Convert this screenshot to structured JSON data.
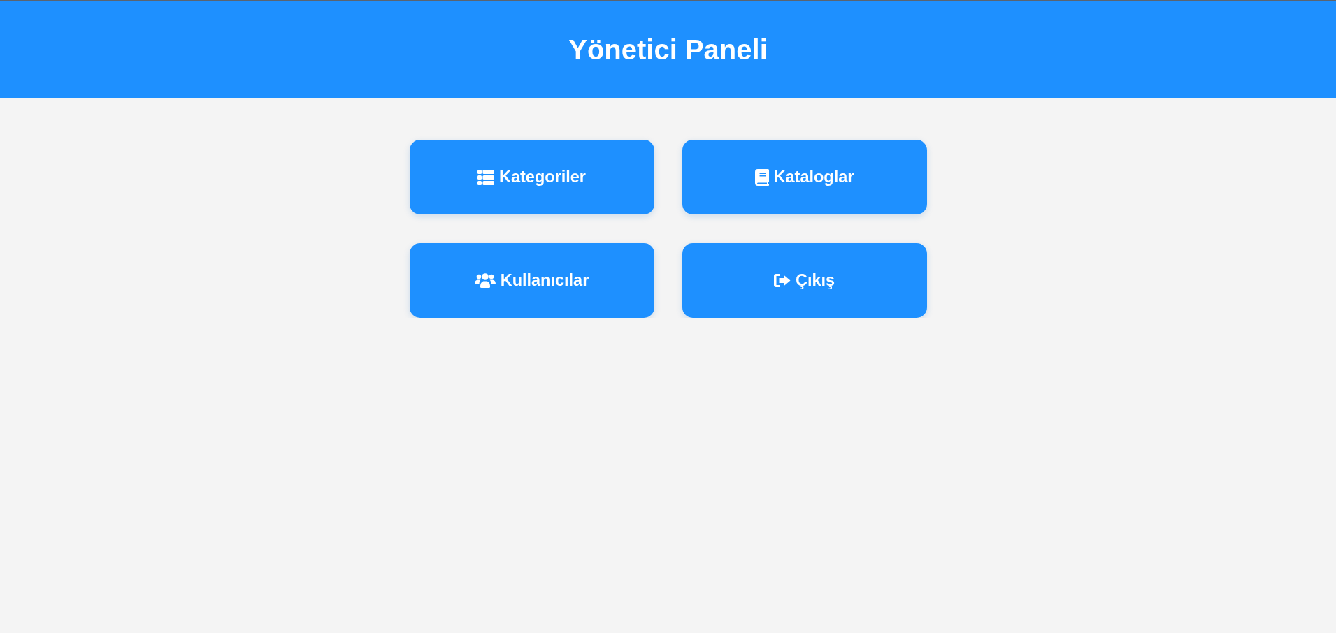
{
  "header": {
    "title": "Yönetici Paneli"
  },
  "menu": [
    {
      "label": "Kategoriler",
      "kind": "list"
    },
    {
      "label": "Kataloglar",
      "kind": "book"
    },
    {
      "label": "Kullanıcılar",
      "kind": "users"
    },
    {
      "label": "Çıkış",
      "kind": "logout"
    }
  ]
}
